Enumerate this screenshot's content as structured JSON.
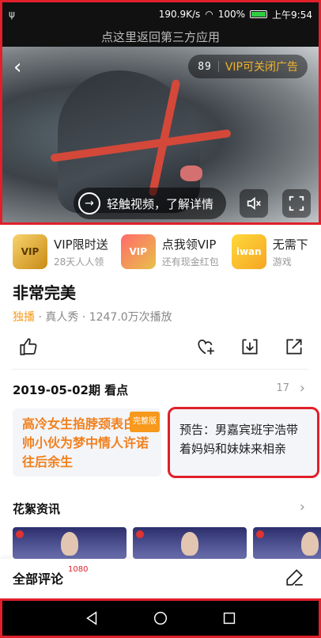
{
  "status": {
    "speed": "190.9K/s",
    "battery": "100%",
    "time": "上午9:54"
  },
  "return_bar": "点这里返回第三方应用",
  "video": {
    "ad_countdown": "89",
    "vip_close_ad": "VIP可关闭广告",
    "cta_text": "轻触视频，了解详情"
  },
  "promos": [
    {
      "title": "VIP限时送",
      "sub": "28天人人领",
      "img_text": "VIP"
    },
    {
      "title": "点我领VIP",
      "sub": "还有现金红包",
      "img_text": "VIP"
    },
    {
      "title": "无需下",
      "sub": "游戏",
      "img_text": "iwan"
    }
  ],
  "show": {
    "title": "非常完美",
    "exclusive": "独播",
    "meta": " · 真人秀 · 1247.0万次播放"
  },
  "episode": {
    "title": "2019-05-02期 看点",
    "count": "17"
  },
  "cards": {
    "left_text": "高冷女生掐脖颈表白，帅小伙为梦中情人许诺往后余生",
    "left_badge": "完整版",
    "right_text": "预告：男嘉宾班宇浩带着妈妈和妹妹来相亲"
  },
  "news": {
    "title": "花絮资讯"
  },
  "comments": {
    "title": "全部评论",
    "count": "1080"
  }
}
